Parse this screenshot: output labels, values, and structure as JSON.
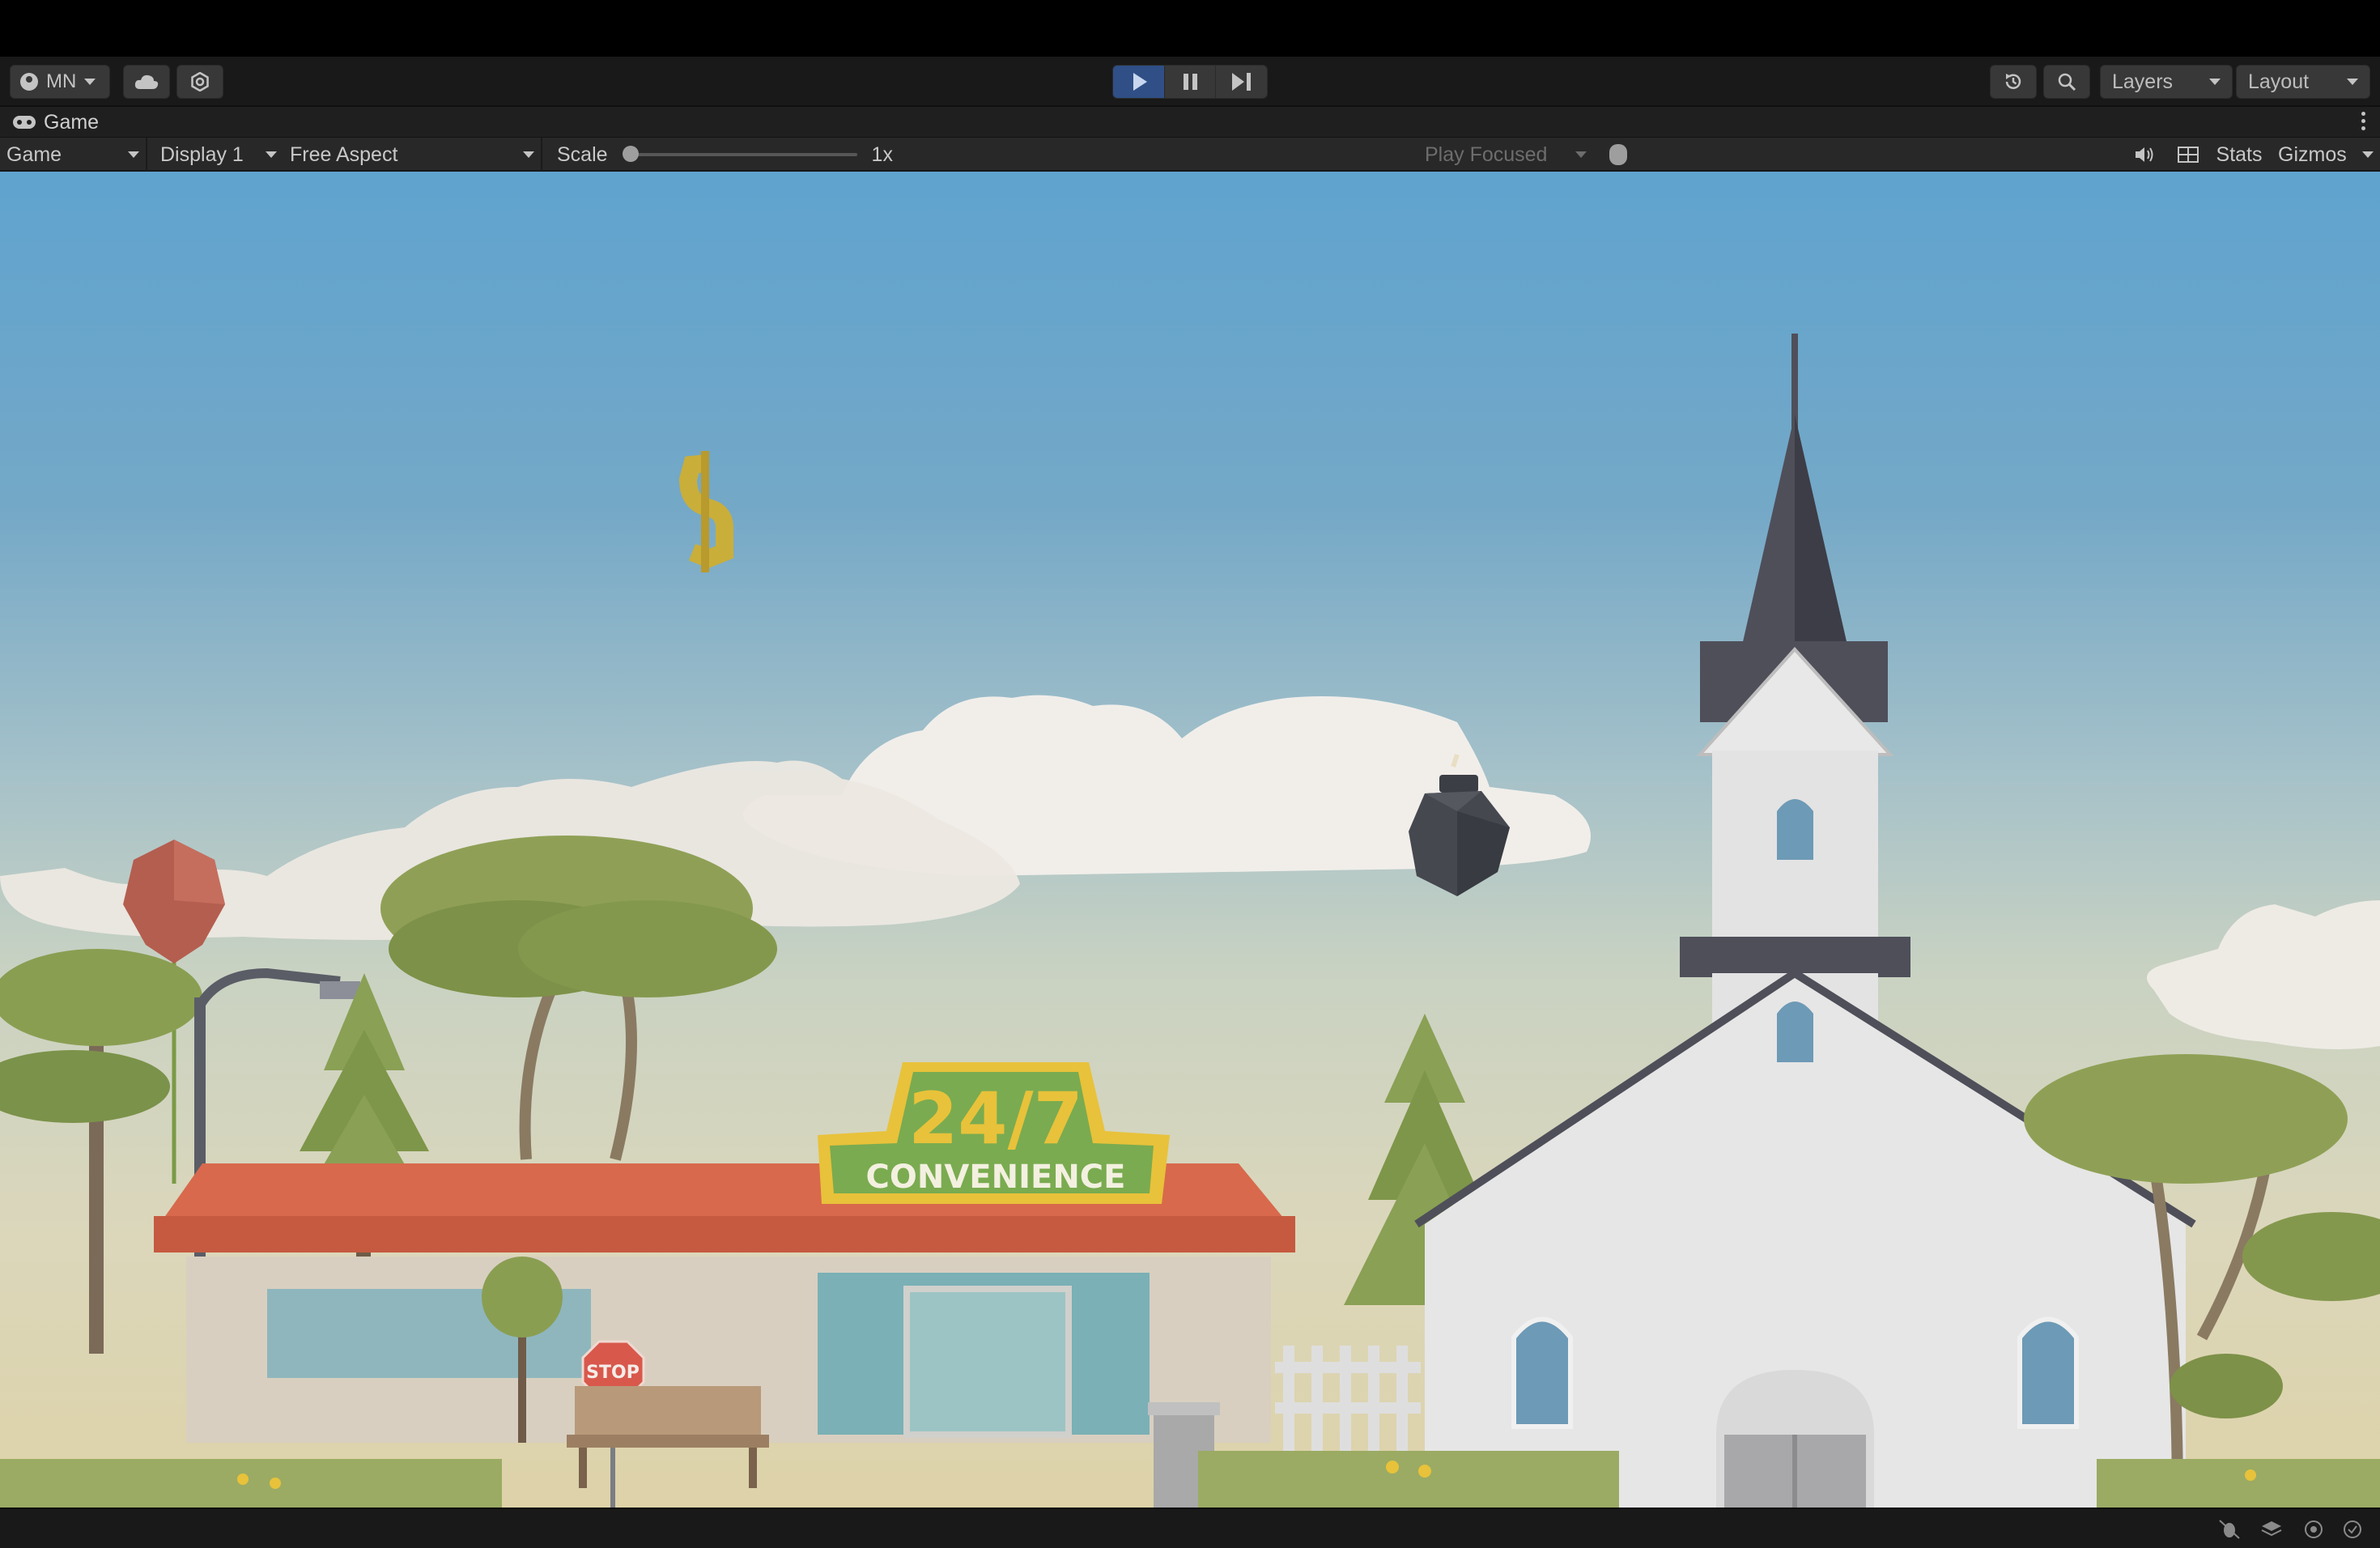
{
  "toolbar": {
    "account_label": "MN",
    "layers_label": "Layers",
    "layout_label": "Layout",
    "icons": [
      "account-icon",
      "cloud-icon",
      "settings-icon",
      "play-icon",
      "pause-icon",
      "step-icon",
      "history-icon",
      "search-icon"
    ]
  },
  "tab": {
    "title": "Game"
  },
  "game_controls": {
    "view_mode": "Game",
    "display": "Display 1",
    "aspect": "Free Aspect",
    "scale_label": "Scale",
    "scale_value": "1x",
    "play_mode": "Play Focused",
    "stats_label": "Stats",
    "gizmos_label": "Gizmos"
  },
  "scene": {
    "store_sign_top": "24/7",
    "store_sign_bottom": "CONVENIENCE",
    "stop_sign": "STOP",
    "colors": {
      "sky_top": "#5fa3cf",
      "sky_bottom": "#ddd2a8",
      "roof": "#d8694c",
      "sign_green": "#7aab50",
      "sign_yellow": "#e8c23a",
      "foliage": "#8a9e52",
      "church": "#e6e6e6",
      "spire": "#4f4f5a"
    }
  }
}
